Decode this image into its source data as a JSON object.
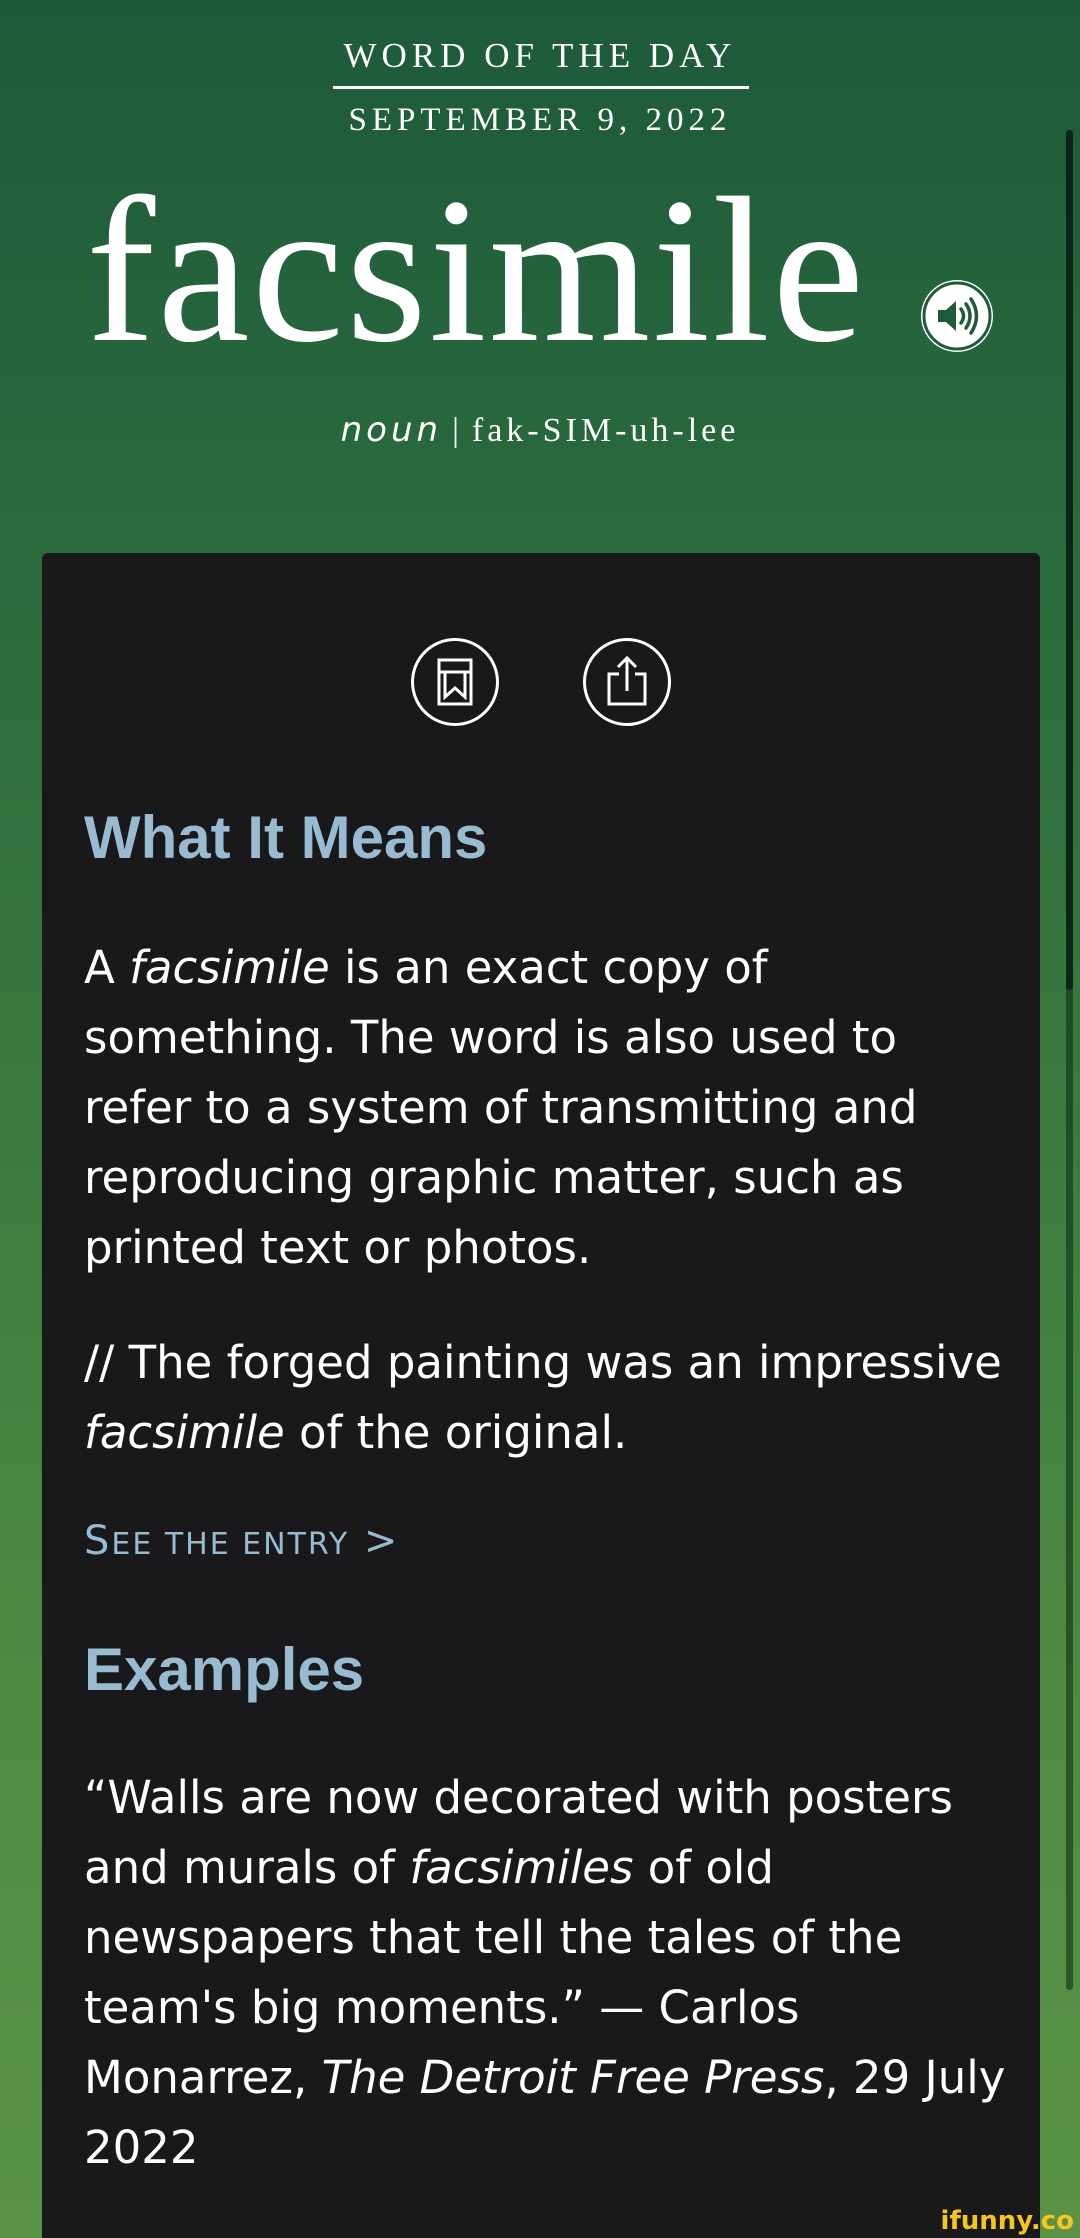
{
  "header": {
    "label": "WORD OF THE DAY",
    "date": "SEPTEMBER 9, 2022",
    "word": "facsimile",
    "part_of_speech": "noun",
    "separator": "|",
    "pronunciation": "fak-SIM-uh-lee",
    "audio_icon": "speaker-icon"
  },
  "actions": {
    "bookmark_icon": "bookmark-icon",
    "share_icon": "share-icon"
  },
  "meaning": {
    "heading": "What It Means",
    "def_1": "A ",
    "def_word": "facsimile",
    "def_2": " is an exact copy of something. The word is also used to refer to a system of transmitting and reproducing graphic matter, such as printed text or photos.",
    "usage_1": "// The forged painting was an impressive ",
    "usage_word": "facsimile",
    "usage_2": " of the original."
  },
  "see_entry": {
    "big_s": "S",
    "rest_1": "EE THE ENTRY",
    "arrow": ">"
  },
  "examples": {
    "heading": "Examples",
    "q_1": "“Walls are now decorated with posters and murals of ",
    "q_word": "facsimiles",
    "q_2": " of old newspapers that tell the tales of the team's big moments.” — Carlos Monarrez, ",
    "q_source": "The Detroit Free Press",
    "q_3": ", 29 July 2022"
  },
  "watermark": "ifunny.co",
  "colors": {
    "accent": "#98bbd2",
    "card_bg": "#19191b",
    "green_top": "#1d5a3b",
    "green_bottom": "#5a9346"
  }
}
